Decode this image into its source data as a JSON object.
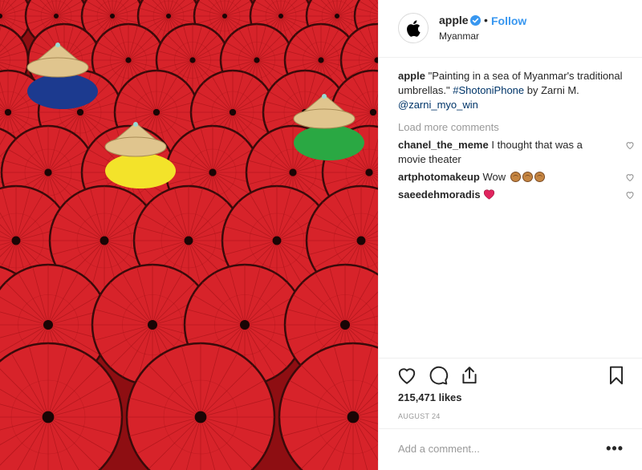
{
  "post": {
    "photo": {
      "scene": "umbrellas",
      "palette": {
        "umbrella": "#d7232a",
        "ribs": "#9c0f14",
        "edge": "#3a0a0a",
        "hat": "#e0c58e",
        "shirt_blue": "#1c3a8f",
        "shirt_yellow": "#f3e32a",
        "shirt_green": "#2aa843"
      }
    },
    "header": {
      "username": "apple",
      "follow_label": "Follow",
      "separator": "•",
      "location": "Myanmar",
      "avatar_icon": "apple-logo-icon",
      "verified_icon": "verified-badge-icon"
    },
    "caption": {
      "username": "apple",
      "text": "\"Painting in a sea of Myanmar's traditional umbrellas.\"",
      "hashtag": "#ShotoniPhone",
      "by": "by Zarni M.",
      "mention": "@zarni_myo_win"
    },
    "load_more": "Load more comments",
    "comments": [
      {
        "user": "chanel_the_meme",
        "text": "I thought that was a movie theater",
        "emoji": ""
      },
      {
        "user": "artphotomakeup",
        "text": "Wow",
        "emoji": "clap-hands x3"
      },
      {
        "user": "saeedehmoradis",
        "text": "",
        "emoji": "red-heart"
      }
    ],
    "actions": {
      "like_icon": "heart-icon",
      "comment_icon": "comment-icon",
      "share_icon": "share-icon",
      "save_icon": "bookmark-icon"
    },
    "likes": "215,471 likes",
    "date": "AUGUST 24",
    "add_comment_placeholder": "Add a comment...",
    "more_label": "•••"
  }
}
